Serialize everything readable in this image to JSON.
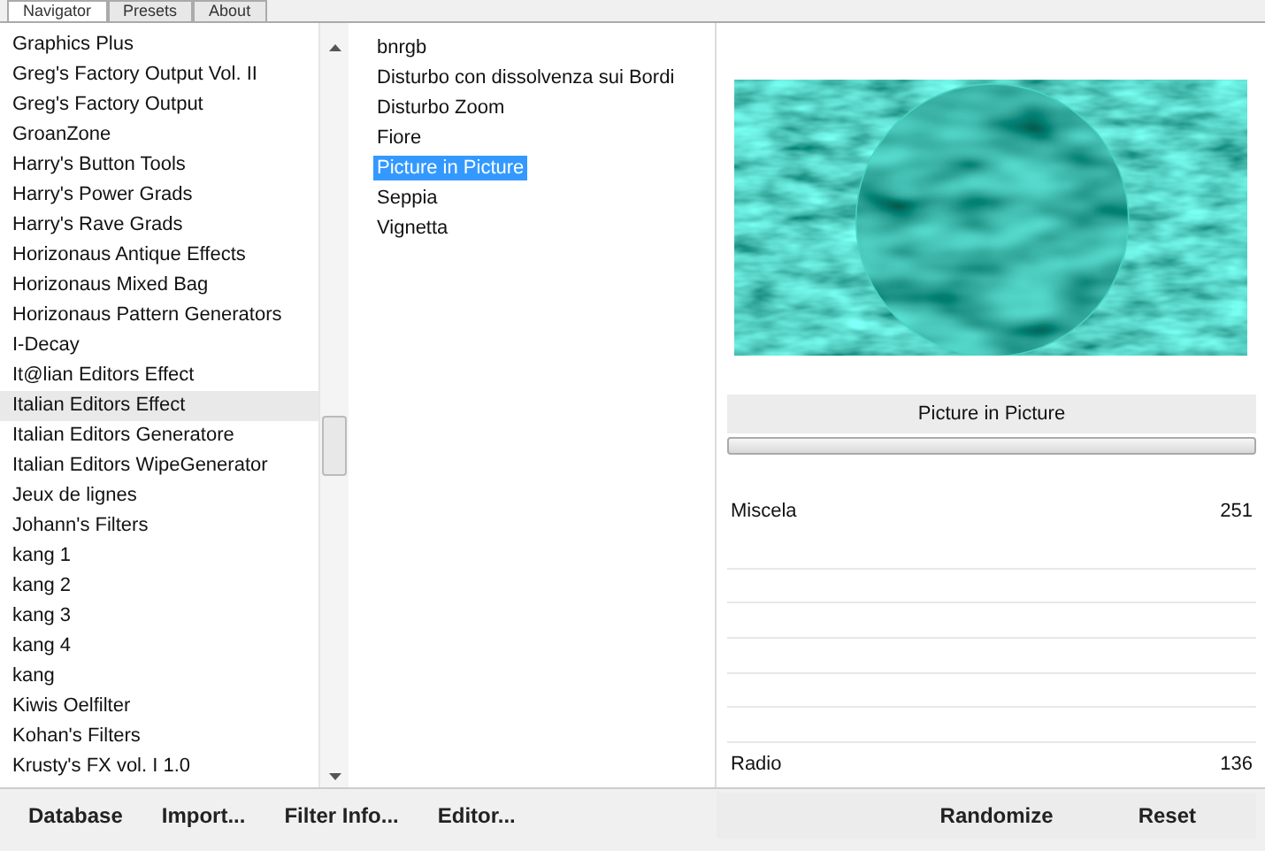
{
  "tabs": [
    {
      "label": "Navigator",
      "selected": true
    },
    {
      "label": "Presets",
      "selected": false
    },
    {
      "label": "About",
      "selected": false
    }
  ],
  "categories": [
    {
      "label": "Graphics Plus",
      "selected": false
    },
    {
      "label": "Greg's Factory Output Vol. II",
      "selected": false
    },
    {
      "label": "Greg's Factory Output",
      "selected": false
    },
    {
      "label": "GroanZone",
      "selected": false
    },
    {
      "label": "Harry's Button Tools",
      "selected": false
    },
    {
      "label": "Harry's Power Grads",
      "selected": false
    },
    {
      "label": "Harry's Rave Grads",
      "selected": false
    },
    {
      "label": "Horizonaus Antique Effects",
      "selected": false
    },
    {
      "label": "Horizonaus Mixed Bag",
      "selected": false
    },
    {
      "label": "Horizonaus Pattern Generators",
      "selected": false
    },
    {
      "label": "I-Decay",
      "selected": false
    },
    {
      "label": "It@lian Editors Effect",
      "selected": false
    },
    {
      "label": "Italian Editors Effect",
      "selected": true
    },
    {
      "label": "Italian Editors Generatore",
      "selected": false
    },
    {
      "label": "Italian Editors WipeGenerator",
      "selected": false
    },
    {
      "label": "Jeux de lignes",
      "selected": false
    },
    {
      "label": "Johann's Filters",
      "selected": false
    },
    {
      "label": "kang 1",
      "selected": false
    },
    {
      "label": "kang 2",
      "selected": false
    },
    {
      "label": "kang 3",
      "selected": false
    },
    {
      "label": "kang 4",
      "selected": false
    },
    {
      "label": "kang",
      "selected": false
    },
    {
      "label": "Kiwis Oelfilter",
      "selected": false
    },
    {
      "label": "Kohan's Filters",
      "selected": false
    },
    {
      "label": "Krusty's FX vol. I 1.0",
      "selected": false
    }
  ],
  "filters": [
    {
      "label": "bnrgb",
      "selected": false
    },
    {
      "label": "Disturbo con dissolvenza sui Bordi",
      "selected": false
    },
    {
      "label": "Disturbo Zoom",
      "selected": false
    },
    {
      "label": "Fiore",
      "selected": false
    },
    {
      "label": "Picture in Picture",
      "selected": true
    },
    {
      "label": "Seppia",
      "selected": false
    },
    {
      "label": "Vignetta",
      "selected": false
    }
  ],
  "filter_title": "Picture in Picture",
  "progress": {
    "level": 0
  },
  "controls": [
    {
      "kind": "value",
      "label": "Miscela",
      "value": "251"
    },
    {
      "kind": "empty"
    },
    {
      "kind": "empty"
    },
    {
      "kind": "empty"
    },
    {
      "kind": "empty"
    },
    {
      "kind": "empty"
    },
    {
      "kind": "empty"
    },
    {
      "kind": "value",
      "label": "Radio",
      "value": "136"
    }
  ],
  "left_buttons": [
    "Database",
    "Import...",
    "Filter Info...",
    "Editor..."
  ],
  "right_buttons": [
    "Randomize",
    "Reset"
  ]
}
